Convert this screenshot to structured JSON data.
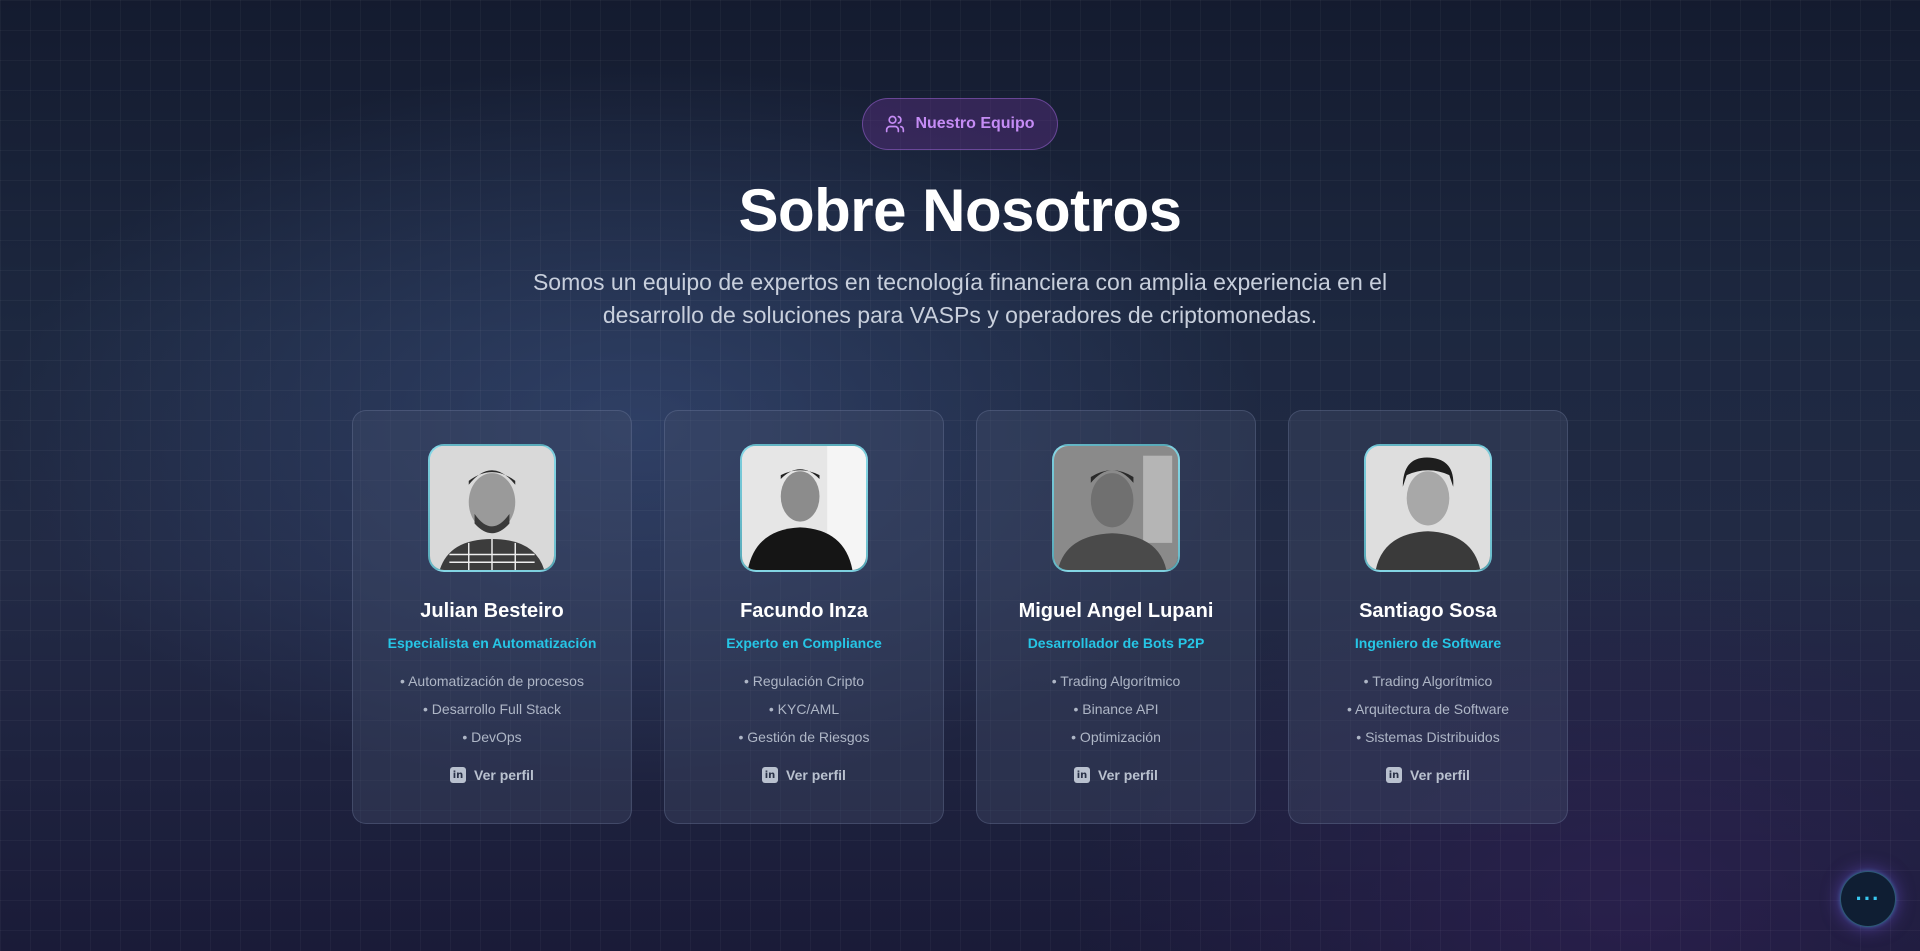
{
  "header": {
    "badge_label": "Nuestro Equipo",
    "badge_icon": "users-icon",
    "title": "Sobre Nosotros",
    "subtitle": "Somos un equipo de expertos en tecnología financiera con amplia experiencia en el desarrollo de soluciones para VASPs y operadores de criptomonedas."
  },
  "team": [
    {
      "name": "Julian Besteiro",
      "role": "Especialista en Automatización",
      "skills": [
        "• Automatización de procesos",
        "• Desarrollo Full Stack",
        "• DevOps"
      ],
      "profile_label": "Ver perfil"
    },
    {
      "name": "Facundo Inza",
      "role": "Experto en Compliance",
      "skills": [
        "• Regulación Cripto",
        "• KYC/AML",
        "• Gestión de Riesgos"
      ],
      "profile_label": "Ver perfil"
    },
    {
      "name": "Miguel Angel Lupani",
      "role": "Desarrollador de Bots P2P",
      "skills": [
        "• Trading Algorítmico",
        "• Binance API",
        "• Optimización"
      ],
      "profile_label": "Ver perfil"
    },
    {
      "name": "Santiago Sosa",
      "role": "Ingeniero de Software",
      "skills": [
        "• Trading Algorítmico",
        "• Arquitectura de Software",
        "• Sistemas Distribuidos"
      ],
      "profile_label": "Ver perfil"
    }
  ],
  "chat_button": {
    "icon": "more-dots-icon",
    "label": "···"
  },
  "colors": {
    "accent_cyan": "#26c6e6",
    "badge_purple": "#c58cf5",
    "background_dark": "#1d2840"
  }
}
